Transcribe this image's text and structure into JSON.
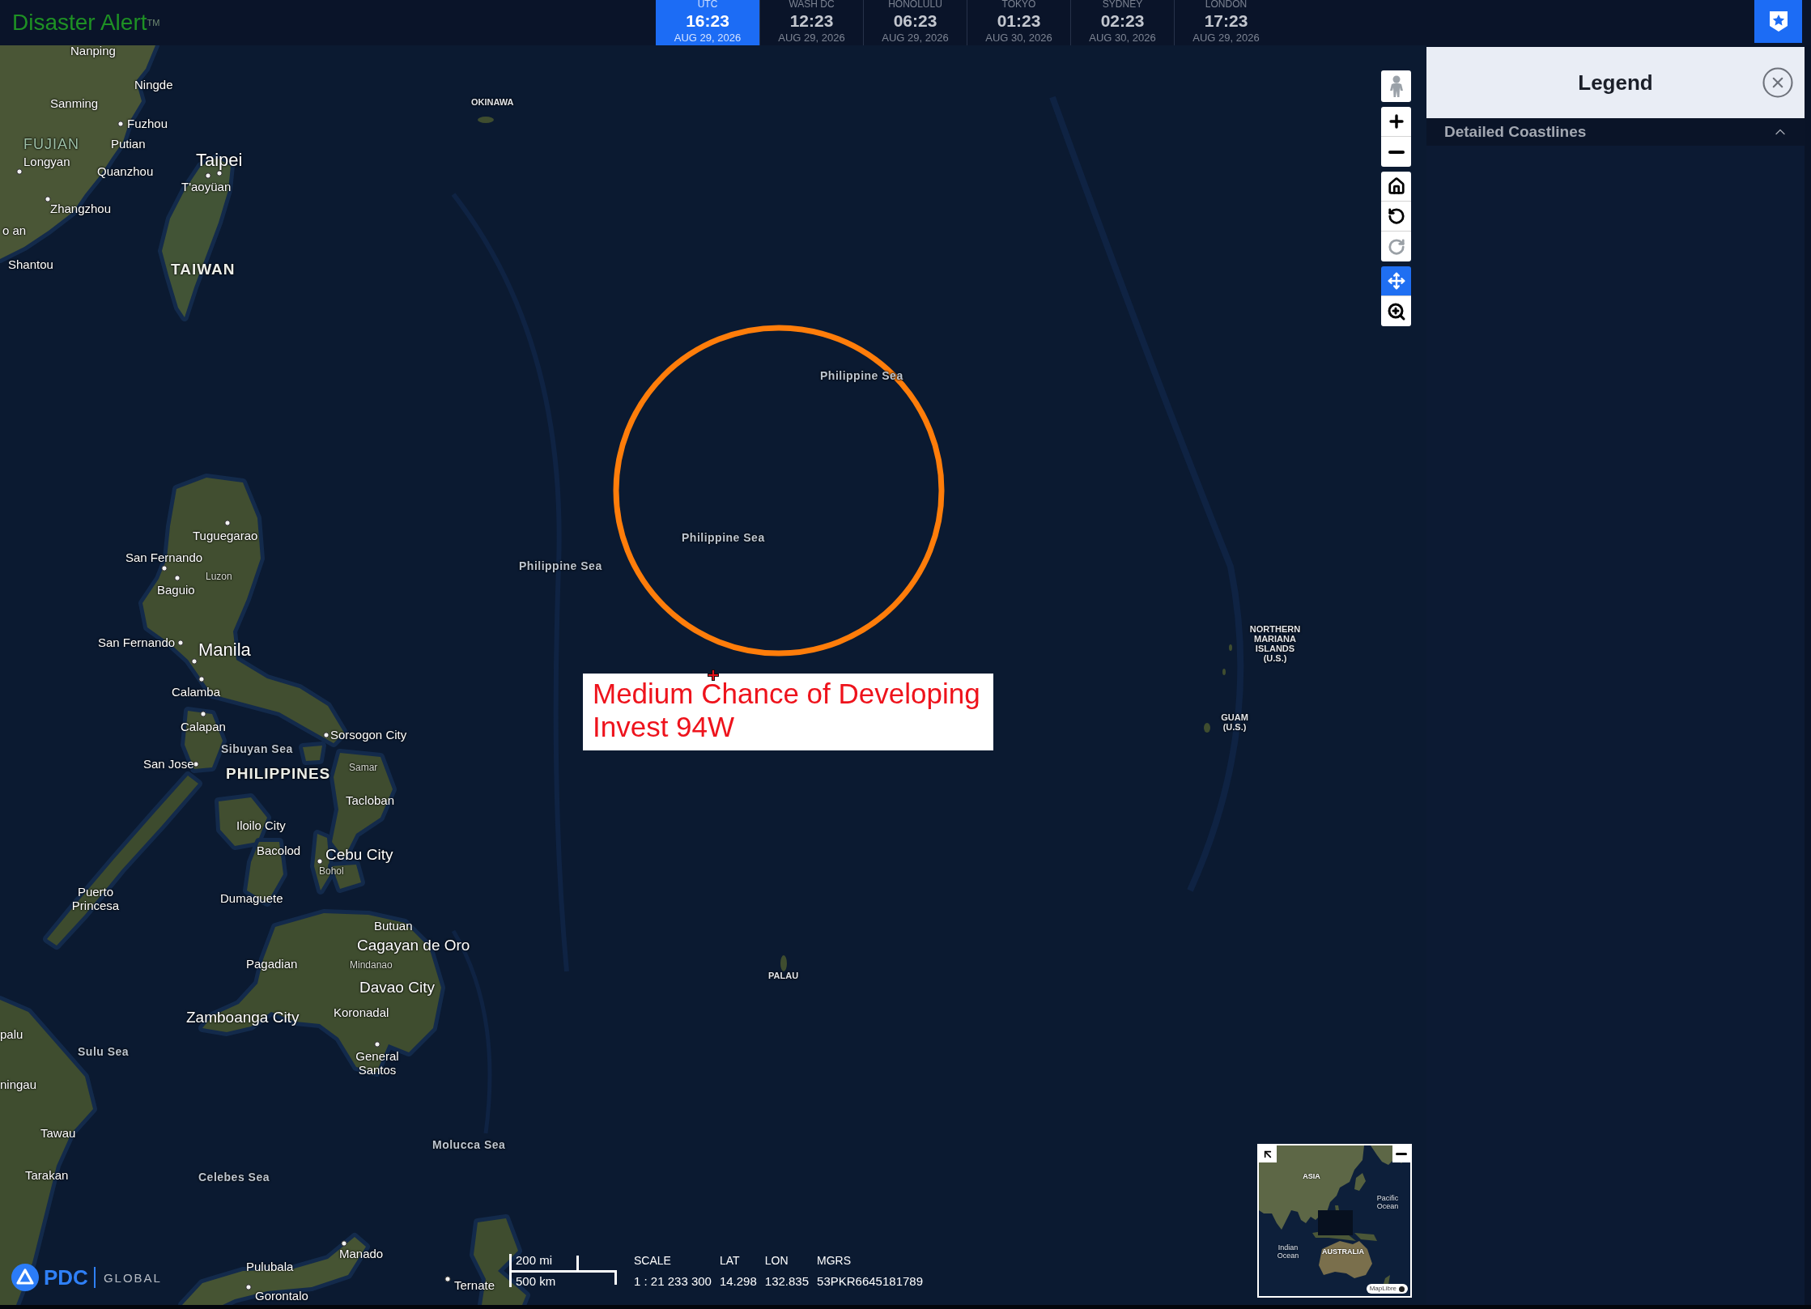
{
  "header": {
    "title": "Disaster Alert$^{TM}$",
    "clocks": [
      {
        "city": "UTC",
        "time": "16:23",
        "date": "AUG 29, 2026",
        "selected": true
      },
      {
        "city": "WASH DC",
        "time": "12:23",
        "date": "AUG 29, 2026",
        "selected": false
      },
      {
        "city": "HONOLULU",
        "time": "06:23",
        "date": "AUG 29, 2026",
        "selected": false
      },
      {
        "city": "TOKYO",
        "time": "01:23",
        "date": "AUG 30, 2026",
        "selected": false
      },
      {
        "city": "SYDNEY",
        "time": "02:23",
        "date": "AUG 30, 2026",
        "selected": false
      },
      {
        "city": "LONDON",
        "time": "17:23",
        "date": "AUG 29, 2026",
        "selected": false
      }
    ]
  },
  "map": {
    "extent_history": [
      {
        "kind": "previous",
        "disabled": false
      },
      {
        "kind": "next",
        "disabled": true
      }
    ],
    "tools": [
      {
        "kind": "pan",
        "selected": true
      },
      {
        "kind": "zoom_box",
        "selected": false
      }
    ],
    "labels": [
      {
        "text": "Nanping",
        "kind": "city"
      },
      {
        "text": "Ningde",
        "kind": "city"
      },
      {
        "text": "Sanming",
        "kind": "city"
      },
      {
        "text": "OKINAWA",
        "kind": "territory"
      },
      {
        "text": "Fuzhou",
        "kind": "city"
      },
      {
        "text": "FUJIAN",
        "kind": "province"
      },
      {
        "text": "Putian",
        "kind": "city"
      },
      {
        "text": "Longyan",
        "kind": "city"
      },
      {
        "text": "Quanzhou",
        "kind": "city"
      },
      {
        "text": "Taipei",
        "kind": "capital"
      },
      {
        "text": "T'aoyüan",
        "kind": "city"
      },
      {
        "text": "Zhangzhou",
        "kind": "city"
      },
      {
        "text": "o an",
        "kind": "city"
      },
      {
        "text": "Shantou",
        "kind": "city"
      },
      {
        "text": "TAIWAN",
        "kind": "country"
      },
      {
        "text": "Philippine Sea",
        "kind": "sea"
      },
      {
        "text": "Tuguegarao",
        "kind": "city"
      },
      {
        "text": "Philippine Sea",
        "kind": "sea"
      },
      {
        "text": "San Fernando",
        "kind": "city"
      },
      {
        "text": "Philippine Sea",
        "kind": "sea"
      },
      {
        "text": "Luzon",
        "kind": "region"
      },
      {
        "text": "Baguio",
        "kind": "city"
      },
      {
        "text": "San Fernando",
        "kind": "city"
      },
      {
        "text": "Manila",
        "kind": "capital"
      },
      {
        "text": "NORTHERN MARIANA ISLANDS (U.S.)",
        "kind": "territory"
      },
      {
        "text": "Calamba",
        "kind": "city"
      },
      {
        "text": "Calapan",
        "kind": "city"
      },
      {
        "text": "Sorsogon City",
        "kind": "city"
      },
      {
        "text": "GUAM (U.S.)",
        "kind": "territory"
      },
      {
        "text": "Sibuyan Sea",
        "kind": "sea"
      },
      {
        "text": "San Jose",
        "kind": "city"
      },
      {
        "text": "PHILIPPINES",
        "kind": "country"
      },
      {
        "text": "Samar",
        "kind": "region"
      },
      {
        "text": "Tacloban",
        "kind": "city"
      },
      {
        "text": "Iloilo City",
        "kind": "city"
      },
      {
        "text": "Bacolod",
        "kind": "city"
      },
      {
        "text": "Cebu City",
        "kind": "city_large"
      },
      {
        "text": "Bohol",
        "kind": "region"
      },
      {
        "text": "Puerto Princesa",
        "kind": "city"
      },
      {
        "text": "Dumaguete",
        "kind": "city"
      },
      {
        "text": "Butuan",
        "kind": "city"
      },
      {
        "text": "Cagayan de Oro",
        "kind": "city_large"
      },
      {
        "text": "Pagadian",
        "kind": "city"
      },
      {
        "text": "Mindanao",
        "kind": "region"
      },
      {
        "text": "PALAU",
        "kind": "territory"
      },
      {
        "text": "Davao City",
        "kind": "city_large"
      },
      {
        "text": "Zamboanga City",
        "kind": "city_large"
      },
      {
        "text": "Koronadal",
        "kind": "city"
      },
      {
        "text": "palu",
        "kind": "city"
      },
      {
        "text": "Sulu Sea",
        "kind": "sea"
      },
      {
        "text": "General Santos",
        "kind": "city"
      },
      {
        "text": "ningau",
        "kind": "city"
      },
      {
        "text": "Tawau",
        "kind": "city"
      },
      {
        "text": "Molucca Sea",
        "kind": "sea"
      },
      {
        "text": "Tarakan",
        "kind": "city"
      },
      {
        "text": "Celebes Sea",
        "kind": "sea"
      },
      {
        "text": "Manado",
        "kind": "city"
      },
      {
        "text": "Pulubala",
        "kind": "city"
      },
      {
        "text": "Ternate",
        "kind": "city"
      },
      {
        "text": "Gorontalo",
        "kind": "city"
      }
    ],
    "storm": {
      "label": "Medium Chance of Developing Invest 94W"
    },
    "overview": {
      "labels": [
        {
          "text": "ASIA",
          "kind": "continent"
        },
        {
          "text": "Pacific Ocean",
          "kind": "ocean"
        },
        {
          "text": "Indian Ocean",
          "kind": "ocean"
        },
        {
          "text": "AUSTRALIA",
          "kind": "continent"
        }
      ],
      "attribution": "MapLibre"
    },
    "logo": {
      "brand": "PDC",
      "suffix": "GLOBAL"
    },
    "scale_bar": {
      "imperial": "200 mi",
      "metric": "500 km"
    },
    "readouts": [
      {
        "label": "SCALE",
        "value": "1 : 21 233 300"
      },
      {
        "label": "LAT",
        "value": "14.298"
      },
      {
        "label": "LON",
        "value": "132.835"
      },
      {
        "label": "MGRS",
        "value": "53PKR6645181789"
      }
    ]
  },
  "legend": {
    "title": "Legend",
    "sections": [
      {
        "title": "Detailed Coastlines",
        "expanded": true
      }
    ]
  }
}
